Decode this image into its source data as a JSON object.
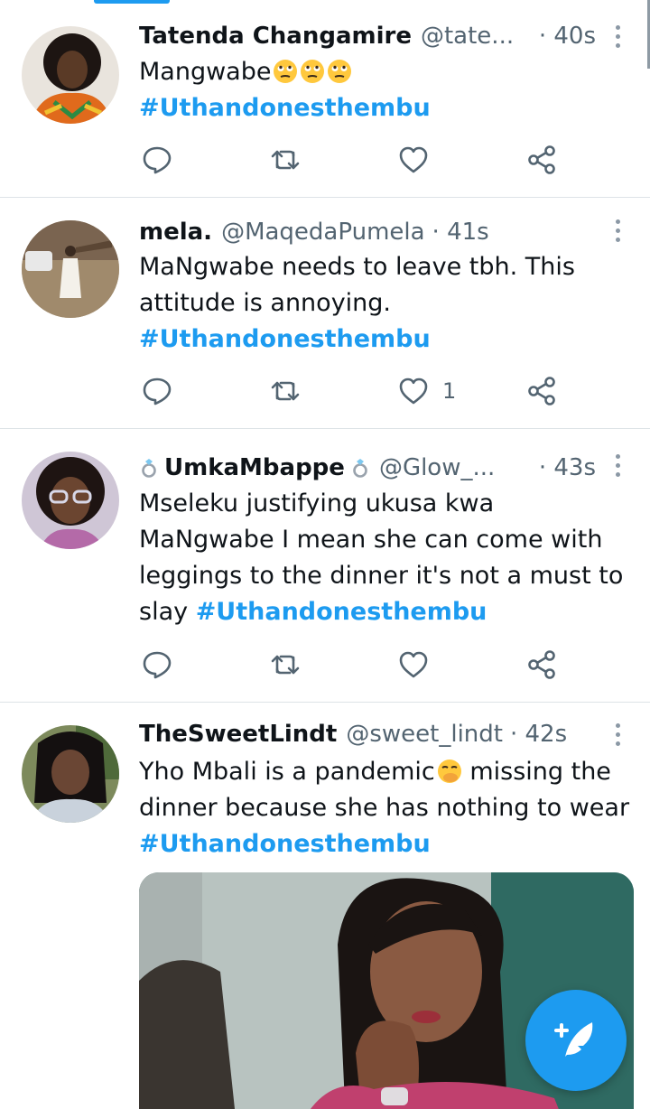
{
  "tweets": [
    {
      "name": "Tatenda Changamire",
      "handle": "@tate...",
      "time": "· 40s",
      "text": "Mangwabe",
      "hashtag": "#Uthandonesthembu",
      "likes": ""
    },
    {
      "name": "mela.",
      "handle": "@MaqedaPumela",
      "time": "· 41s",
      "text": "MaNgwabe needs to leave tbh. This attitude is annoying.",
      "hashtag": "#Uthandonesthembu",
      "likes": "1"
    },
    {
      "name": "UmkaMbappe",
      "handle": "@Glow_...",
      "time": "· 43s",
      "text": "Mseleku justifying ukusa kwa MaNgwabe I mean she can come with leggings to the dinner it's not a must to slay",
      "hashtag": "#Uthandonesthembu",
      "likes": ""
    },
    {
      "name": "TheSweetLindt",
      "handle": "@sweet_lindt",
      "time": "· 42s",
      "text_before": "Yho Mbali is a pandemic",
      "text_after": " missing the dinner because she has nothing to wear",
      "hashtag": "#Uthandonesthembu"
    }
  ],
  "icons": {
    "reply": "speech-bubble-icon",
    "retweet": "retweet-icon",
    "like": "heart-icon",
    "share": "share-icon",
    "more": "vertical-dots-icon",
    "compose": "feather-plus-icon"
  },
  "colors": {
    "accent": "#1d9bf0",
    "secondary_text": "#536471",
    "divider": "#dde3e7"
  }
}
